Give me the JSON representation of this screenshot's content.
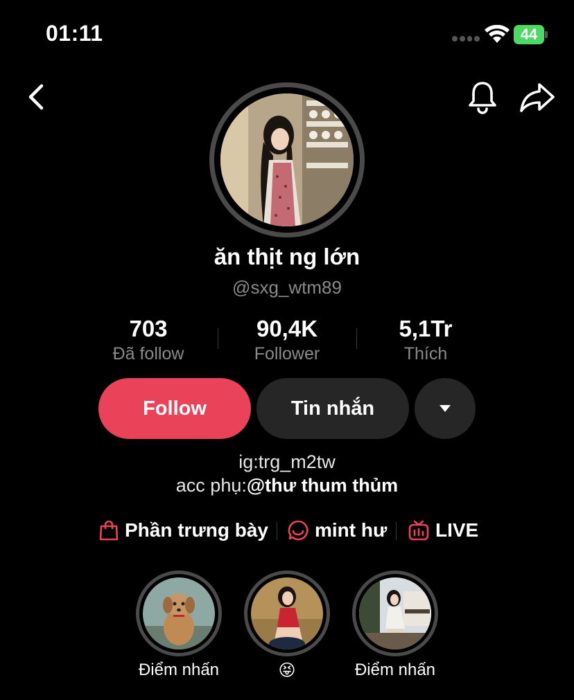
{
  "status_bar": {
    "time": "01:11",
    "battery": "44"
  },
  "profile": {
    "display_name": "ăn thịt ng lớn",
    "username": "@sxg_wtm89"
  },
  "stats": [
    {
      "value": "703",
      "label": "Đã follow"
    },
    {
      "value": "90,4K",
      "label": "Follower"
    },
    {
      "value": "5,1Tr",
      "label": "Thích"
    }
  ],
  "actions": {
    "follow_label": "Follow",
    "message_label": "Tin nhắn"
  },
  "bio": {
    "line1": "ig:trg_m2tw",
    "line2_prefix": "acc phụ:",
    "line2_mention": "@thư thum thủm"
  },
  "links": [
    {
      "label": "Phần trưng bày",
      "icon": "shopping-bag-icon"
    },
    {
      "label": "mint hư",
      "icon": "chat-bubble-icon"
    },
    {
      "label": "LIVE",
      "icon": "live-tv-icon"
    }
  ],
  "highlights": [
    {
      "label": "Điểm nhấn"
    },
    {
      "label": "😝"
    },
    {
      "label": "Điểm nhấn"
    }
  ],
  "colors": {
    "follow": "#ea4359",
    "icon_accent": "#ea4359",
    "battery": "#4cd964"
  }
}
